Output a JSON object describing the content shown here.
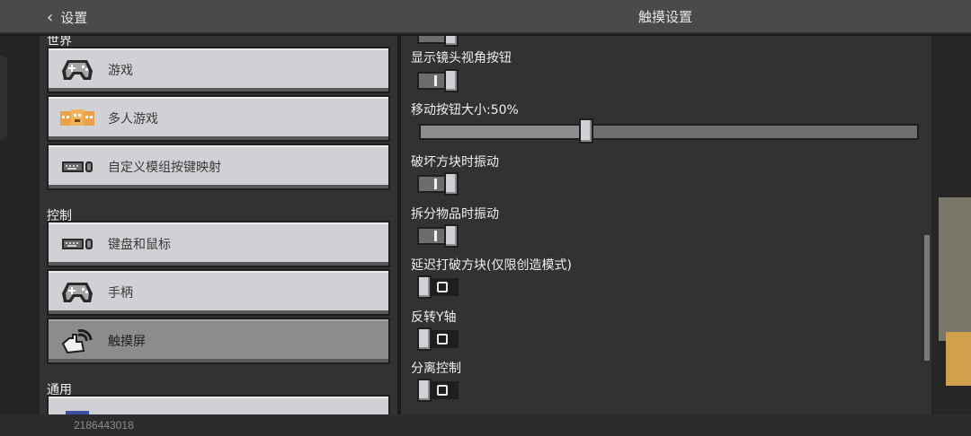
{
  "header": {
    "back_label": "设置",
    "title": "触摸设置"
  },
  "left": {
    "sections": [
      {
        "label": "世界"
      },
      {
        "label": "控制"
      },
      {
        "label": "通用"
      }
    ],
    "items": [
      {
        "label": "游戏",
        "icon": "gamepad-icon"
      },
      {
        "label": "多人游戏",
        "icon": "players-icon"
      },
      {
        "label": "自定义模组按键映射",
        "icon": "keyboard-mouse-icon"
      },
      {
        "label": "键盘和鼠标",
        "icon": "keyboard-mouse-icon"
      },
      {
        "label": "手柄",
        "icon": "gamepad-icon"
      },
      {
        "label": "触摸屏",
        "icon": "touch-icon",
        "selected": true
      }
    ]
  },
  "right": {
    "settings": [
      {
        "label": "显示镜头视角按钮",
        "value": "on"
      },
      {
        "label": "移动按钮大小:50%",
        "value": 0.5
      },
      {
        "label": "破坏方块时振动",
        "value": "on"
      },
      {
        "label": "拆分物品时振动",
        "value": "on"
      },
      {
        "label": "延迟打破方块(仅限创造模式)",
        "value": "off"
      },
      {
        "label": "反转Y轴",
        "value": "off"
      },
      {
        "label": "分离控制",
        "value": "off"
      }
    ]
  },
  "watermark": "2186443018"
}
